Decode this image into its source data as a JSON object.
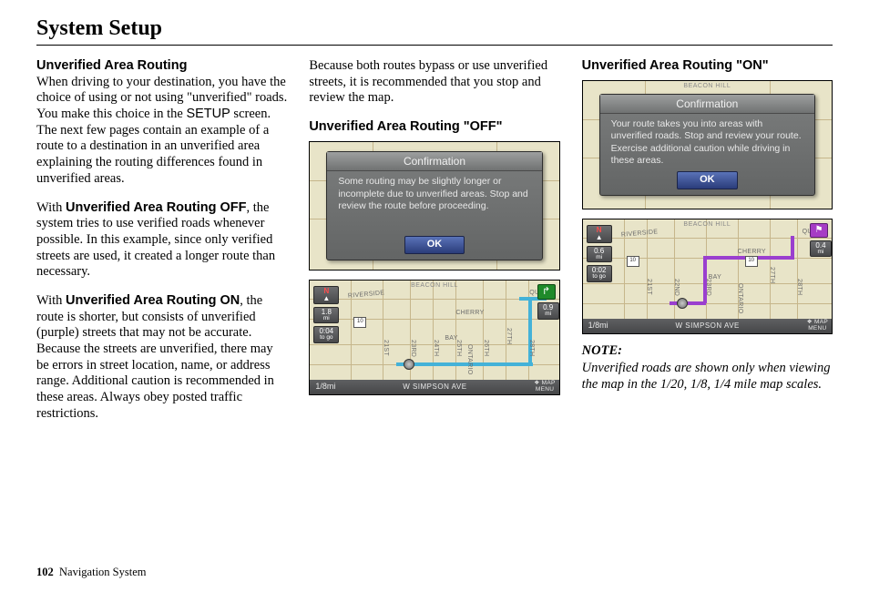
{
  "title": "System Setup",
  "footer": {
    "page_num": "102",
    "section": "Navigation System"
  },
  "col1": {
    "h1": "Unverified Area Routing",
    "p1a": "When driving to your destination, you have the choice of using or not using \"unverified\" roads. You make this choice in the ",
    "p1_setup": "SETUP",
    "p1b": " screen. The next few pages contain an example of a route to a destination in an unverified area explaining the routing differences found in unverified areas.",
    "p2a": "With ",
    "p2_bold": "Unverified Area Routing OFF",
    "p2b": ", the system tries to use verified roads whenever possible. In this example, since only verified streets are used, it created a longer route than necessary.",
    "p3a": "With ",
    "p3_bold": "Unverified Area Routing ON",
    "p3b": ", the route is shorter, but consists of unverified (purple) streets that may not be accurate. Because the streets are unverified, there may be errors in street location, name, or address range. Additional caution is recommended in these areas. Always obey posted traffic restrictions."
  },
  "col2": {
    "intro": "Because both routes bypass or use unverified streets, it is recommended that you stop and review the map.",
    "h_off": "Unverified Area Routing \"OFF\"",
    "dialog_off": {
      "title": "Confirmation",
      "body": "Some routing may be slightly longer or incomplete due to unverified areas. Stop and review the route before proceeding.",
      "ok": "OK"
    },
    "map_off": {
      "beacon": "BEACON HILL",
      "cherry": "CHERRY",
      "bay": "BAY",
      "riverside": "RIVERSIDE",
      "queen": "QUEEN",
      "s21": "21ST",
      "s23": "23RD",
      "s24": "24TH",
      "s25": "25TH",
      "s26": "26TH",
      "s27": "27TH",
      "s28": "28TH",
      "ontario": "ONTARIO",
      "hwy": "10",
      "compass_n": "N",
      "dist1": "1.8",
      "dist1_sub": "mi",
      "time": "0:04",
      "time_sub": "to go",
      "turn_dist": "0.9",
      "turn_dist_sub": "mi",
      "scale": "1/8mi",
      "street": "W SIMPSON AVE",
      "menu1": "MAP",
      "menu2": "MENU"
    }
  },
  "col3": {
    "h_on": "Unverified Area Routing \"ON\"",
    "dialog_on": {
      "title": "Confirmation",
      "body": "Your route takes you into areas with unverified roads. Stop and review your route. Exercise additional caution while driving in these areas.",
      "ok": "OK"
    },
    "map_on": {
      "beacon": "BEACON HILL",
      "cherry": "CHERRY",
      "bay": "BAY",
      "riverside": "RIVERSIDE",
      "queen": "QUEEN",
      "s21": "21ST",
      "s22": "22ND",
      "s23": "23RD",
      "s27": "27TH",
      "s28": "28TH",
      "ontario": "ONTARIO",
      "hwy": "10",
      "compass_n": "N",
      "dist1": "0.6",
      "dist1_sub": "mi",
      "time": "0:02",
      "time_sub": "to go",
      "turn_dist": "0.4",
      "turn_dist_sub": "mi",
      "scale": "1/8mi",
      "street": "W SIMPSON AVE",
      "menu1": "MAP",
      "menu2": "MENU"
    },
    "note_head": "NOTE:",
    "note_body": "Unverified roads are shown only when viewing the map in the 1/20, 1/8, 1/4 mile map scales."
  }
}
